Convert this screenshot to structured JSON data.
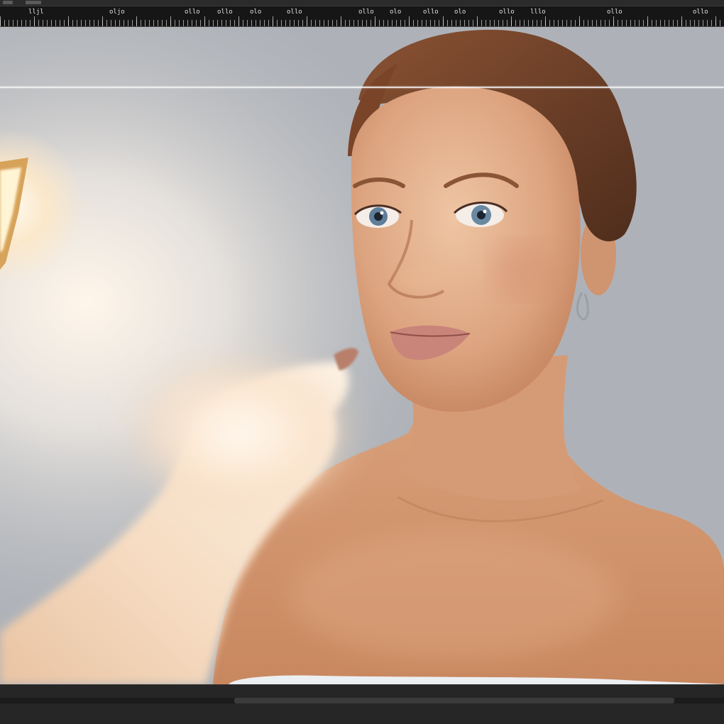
{
  "ruler": {
    "labels": [
      "lljl",
      "oljo",
      "ollo",
      "ollo",
      "olo",
      "ollo",
      "ollo",
      "olo",
      "ollo",
      "olo",
      "ollo",
      "lllo",
      "ollo",
      "ollo"
    ]
  },
  "colors": {
    "canvas_bg": "#aeb2b8",
    "guide": "#f2f2f2",
    "skin": "#d9a17c",
    "hair": "#6b3e25"
  }
}
